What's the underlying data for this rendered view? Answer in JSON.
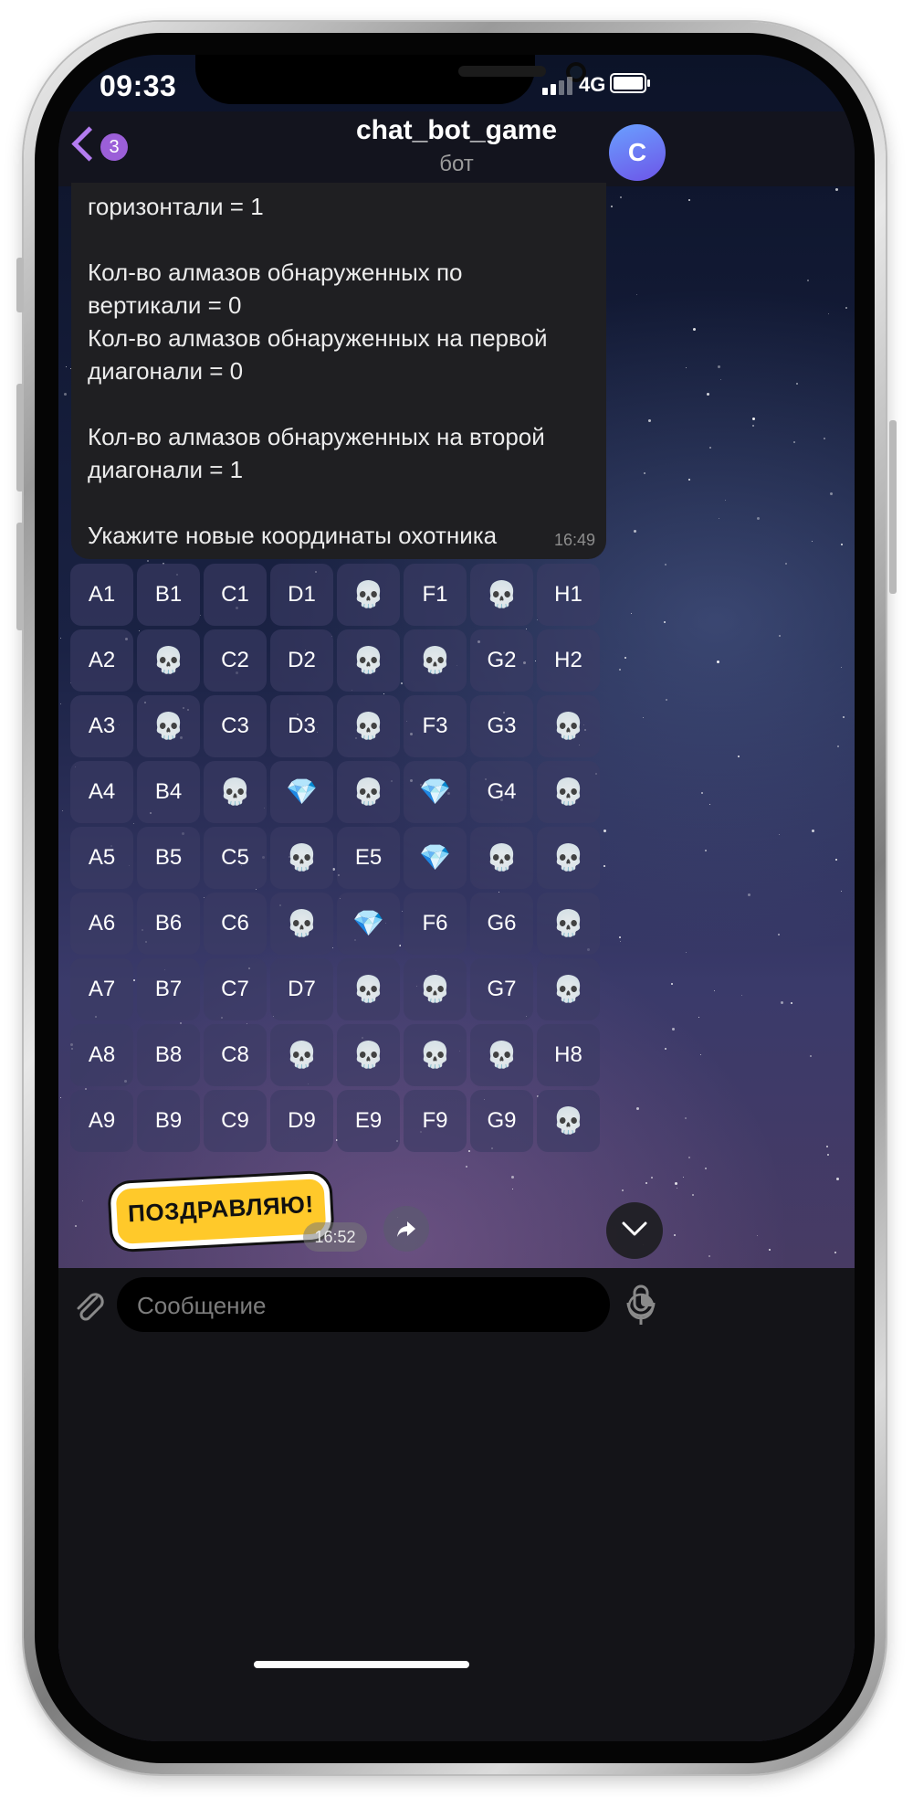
{
  "status_bar": {
    "time": "09:33",
    "network": "4G"
  },
  "header": {
    "back_badge": "3",
    "title": "chat_bot_game",
    "subtitle": "бот",
    "avatar_letter": "С"
  },
  "message": {
    "lines": [
      "горизонтали = 1",
      "",
      "Кол-во алмазов обнаруженных по",
      "вертикали = 0",
      "Кол-во алмазов обнаруженных на первой",
      "диагонали = 0",
      "",
      "Кол-во алмазов обнаруженных на второй",
      "диагонали = 1",
      "",
      "Укажите новые координаты охотника"
    ],
    "time": "16:49"
  },
  "board": {
    "skull_icon": "💀",
    "diamond_icon": "💎",
    "rows": [
      [
        "A1",
        "B1",
        "C1",
        "D1",
        "skull",
        "F1",
        "skull",
        "H1"
      ],
      [
        "A2",
        "skull",
        "C2",
        "D2",
        "skull",
        "skull",
        "G2",
        "H2"
      ],
      [
        "A3",
        "skull",
        "C3",
        "D3",
        "skull",
        "F3",
        "G3",
        "skull"
      ],
      [
        "A4",
        "B4",
        "skull",
        "diamond",
        "skull",
        "diamond",
        "G4",
        "skull"
      ],
      [
        "A5",
        "B5",
        "C5",
        "skull",
        "E5",
        "diamond",
        "skull",
        "skull"
      ],
      [
        "A6",
        "B6",
        "C6",
        "skull",
        "diamond",
        "F6",
        "G6",
        "skull"
      ],
      [
        "A7",
        "B7",
        "C7",
        "D7",
        "skull",
        "skull",
        "G7",
        "skull"
      ],
      [
        "A8",
        "B8",
        "C8",
        "skull",
        "skull",
        "skull",
        "skull",
        "H8"
      ],
      [
        "A9",
        "B9",
        "C9",
        "D9",
        "E9",
        "F9",
        "G9",
        "skull"
      ]
    ]
  },
  "sticker": {
    "text": "ПОЗДРАВЛЯЮ!",
    "time": "16:52"
  },
  "input": {
    "placeholder": "Сообщение"
  },
  "colors": {
    "accent": "#b37cf0",
    "bubble": "#1f1f22",
    "key": "#3c3c64"
  }
}
